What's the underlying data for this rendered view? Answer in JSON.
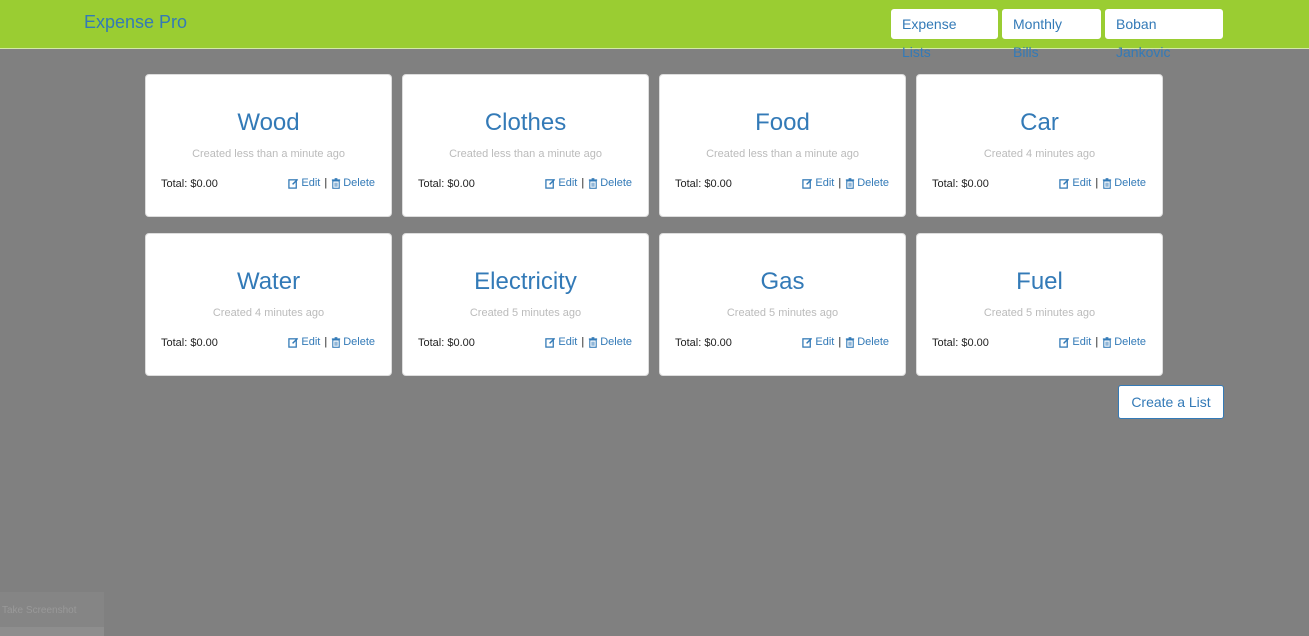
{
  "app": {
    "brand": "Expense Pro"
  },
  "nav": {
    "expense_lists": "Expense Lists",
    "monthly_bills": "Monthly Bills",
    "user": "Boban Jankovic"
  },
  "lists": [
    {
      "title": "Wood",
      "created": "Created less than a minute ago",
      "total": "Total: $0.00",
      "edit": "Edit",
      "delete": "Delete"
    },
    {
      "title": "Clothes",
      "created": "Created less than a minute ago",
      "total": "Total: $0.00",
      "edit": "Edit",
      "delete": "Delete"
    },
    {
      "title": "Food",
      "created": "Created less than a minute ago",
      "total": "Total: $0.00",
      "edit": "Edit",
      "delete": "Delete"
    },
    {
      "title": "Car",
      "created": "Created 4 minutes ago",
      "total": "Total: $0.00",
      "edit": "Edit",
      "delete": "Delete"
    },
    {
      "title": "Water",
      "created": "Created 4 minutes ago",
      "total": "Total: $0.00",
      "edit": "Edit",
      "delete": "Delete"
    },
    {
      "title": "Electricity",
      "created": "Created 5 minutes ago",
      "total": "Total: $0.00",
      "edit": "Edit",
      "delete": "Delete"
    },
    {
      "title": "Gas",
      "created": "Created 5 minutes ago",
      "total": "Total: $0.00",
      "edit": "Edit",
      "delete": "Delete"
    },
    {
      "title": "Fuel",
      "created": "Created 5 minutes ago",
      "total": "Total: $0.00",
      "edit": "Edit",
      "delete": "Delete"
    }
  ],
  "actions": {
    "create_list": "Create a List",
    "separator": "|"
  },
  "overlay": {
    "take_screenshot": "Take Screenshot"
  },
  "icons": {
    "edit": "edit-icon",
    "delete": "trash-icon"
  },
  "colors": {
    "navbar": "#9acd32",
    "accent": "#337ab7",
    "background": "#808080"
  }
}
